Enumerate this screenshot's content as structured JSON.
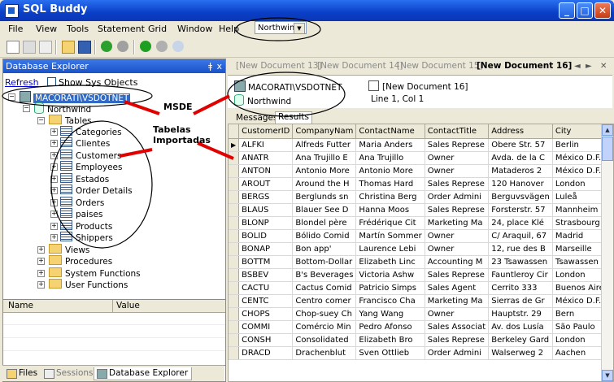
{
  "window": {
    "title": "SQL Buddy",
    "min": "_",
    "max": "□",
    "close": "✕"
  },
  "menu": [
    "File",
    "View",
    "Tools",
    "Statement",
    "Grid",
    "Window",
    "Help"
  ],
  "db_selector": {
    "value": "Northwind"
  },
  "explorer": {
    "title": "Database Explorer",
    "pin": "ǂ",
    "close": "x",
    "refresh": "Refresh",
    "show_sys": "Show Sys Objects",
    "server": "MACORATI\\VSDOTNET",
    "database": "Northwind",
    "tables_folder": "Tables",
    "tables": [
      "Categories",
      "Clientes",
      "Customers",
      "Employees",
      "Estados",
      "Order Details",
      "Orders",
      "paises",
      "Products",
      "Shippers"
    ],
    "folders": [
      "Views",
      "Procedures",
      "System Functions",
      "User Functions"
    ]
  },
  "properties": {
    "name_col": "Name",
    "value_col": "Value"
  },
  "bottom_tabs": [
    "Files",
    "Sessions",
    "Database Explorer"
  ],
  "doc_tabs": [
    "[New Document 13]",
    "[New Document 14]",
    "[New Document 15]",
    "[New Document 16]"
  ],
  "doc_info": {
    "server": "MACORATI\\VSDOTNET",
    "database": "Northwind",
    "doc": "[New Document 16]",
    "position": "Line 1, Col 1"
  },
  "result_tabs": [
    "Messages",
    "Results"
  ],
  "grid": {
    "columns": [
      "CustomerID",
      "CompanyNam",
      "ContactName",
      "ContactTitle",
      "Address",
      "City",
      "("
    ],
    "rows": [
      [
        "ALFKI",
        "Alfreds Futter",
        "Maria Anders",
        "Sales Represe",
        "Obere Str. 57",
        "Berlin",
        "("
      ],
      [
        "ANATR",
        "Ana Trujillo E",
        "Ana Trujillo",
        "Owner",
        "Avda. de la C",
        "México D.F.",
        "("
      ],
      [
        "ANTON",
        "Antonio More",
        "Antonio More",
        "Owner",
        "Mataderos 2",
        "México D.F.",
        "("
      ],
      [
        "AROUT",
        "Around the H",
        "Thomas Hard",
        "Sales Represe",
        "120 Hanover",
        "London",
        "("
      ],
      [
        "BERGS",
        "Berglunds sn",
        "Christina Berg",
        "Order Admini",
        "Berguvsvägen",
        "Luleå",
        "("
      ],
      [
        "BLAUS",
        "Blauer See D",
        "Hanna Moos",
        "Sales Represe",
        "Forsterstr. 57",
        "Mannheim",
        "("
      ],
      [
        "BLONP",
        "Blondel père",
        "Frédérique Cit",
        "Marketing Ma",
        "24, place Klé",
        "Strasbourg",
        "("
      ],
      [
        "BOLID",
        "Bólido Comid",
        "Martín Sommer",
        "Owner",
        "C/ Araquil, 67",
        "Madrid",
        "("
      ],
      [
        "BONAP",
        "Bon app'",
        "Laurence Lebi",
        "Owner",
        "12, rue des B",
        "Marseille",
        "("
      ],
      [
        "BOTTM",
        "Bottom-Dollar",
        "Elizabeth Linc",
        "Accounting M",
        "23 Tsawassen",
        "Tsawassen",
        "E"
      ],
      [
        "BSBEV",
        "B's Beverages",
        "Victoria Ashw",
        "Sales Represe",
        "Fauntleroy Cir",
        "London",
        "("
      ],
      [
        "CACTU",
        "Cactus Comid",
        "Patricio Simps",
        "Sales Agent",
        "Cerrito 333",
        "Buenos Aires",
        "("
      ],
      [
        "CENTC",
        "Centro comer",
        "Francisco Cha",
        "Marketing Ma",
        "Sierras de Gr",
        "México D.F.",
        "("
      ],
      [
        "CHOPS",
        "Chop-suey Ch",
        "Yang Wang",
        "Owner",
        "Hauptstr. 29",
        "Bern",
        "("
      ],
      [
        "COMMI",
        "Comércio Min",
        "Pedro Afonso",
        "Sales Associat",
        "Av. dos Lusía",
        "São Paulo",
        "S"
      ],
      [
        "CONSH",
        "Consolidated",
        "Elizabeth Bro",
        "Sales Represe",
        "Berkeley Gard",
        "London",
        "("
      ],
      [
        "DRACD",
        "Drachenblut",
        "Sven Ottlieb",
        "Order Admini",
        "Walserweg 2",
        "Aachen",
        "("
      ]
    ]
  },
  "annotations": {
    "msde": "MSDE",
    "tabelas1": "Tabelas",
    "tabelas2": "Importadas"
  }
}
